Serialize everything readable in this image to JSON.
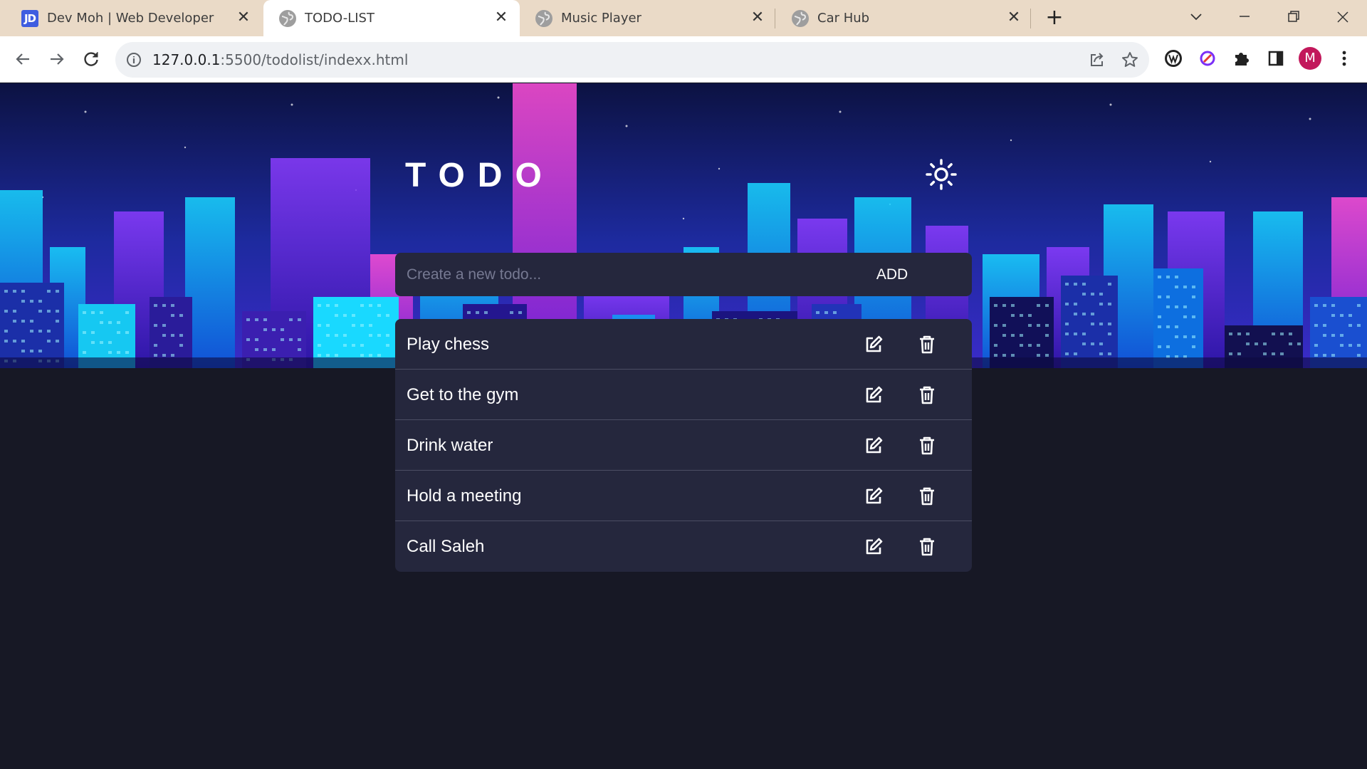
{
  "browser": {
    "tabs": [
      {
        "title": "Dev Moh | Web Developer",
        "favicon": "JD",
        "active": false
      },
      {
        "title": "TODO-LIST",
        "favicon": "globe-icon",
        "active": true
      },
      {
        "title": "Music Player",
        "favicon": "globe-icon",
        "active": false
      },
      {
        "title": "Car Hub",
        "favicon": "globe-icon",
        "active": false
      }
    ],
    "url_host": "127.0.0.1",
    "url_rest": ":5500/todolist/indexx.html",
    "profile_initial": "M"
  },
  "app": {
    "heading": "TODO",
    "input_placeholder": "Create a new todo...",
    "add_label": "ADD",
    "todos": [
      {
        "text": "Play chess"
      },
      {
        "text": "Get to the gym"
      },
      {
        "text": "Drink water"
      },
      {
        "text": "Hold a meeting"
      },
      {
        "text": "Call Saleh"
      }
    ]
  },
  "colors": {
    "background": "#171825",
    "card": "#25273d",
    "divider": "#4b4d63",
    "tabstrip": "#eadac7"
  }
}
